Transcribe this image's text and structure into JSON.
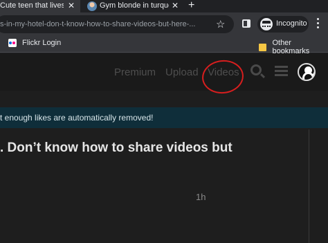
{
  "browser": {
    "tabs": [
      {
        "title": "Cute teen that lives in",
        "active": true
      },
      {
        "title": "Gym blonde in turquoi",
        "active": false
      }
    ],
    "close_glyph": "✕",
    "new_tab_glyph": "+",
    "url": "s-in-my-hotel-don-t-know-how-to-share-videos-but-here-...",
    "star_glyph": "☆",
    "incognito_label": "Incognito",
    "bookmarks": [
      {
        "label": "Flickr Login",
        "icon": "flickr-icon"
      },
      {
        "label": "Other bookmarks",
        "icon": "folder-icon"
      }
    ]
  },
  "site": {
    "nav": [
      "Premium",
      "Upload",
      "Videos"
    ],
    "icons": [
      "search-icon",
      "hamburger-icon",
      "yinyang-icon"
    ],
    "notice": "t enough likes are automatically removed!",
    "post_title": ". Don’t know how to share videos but",
    "post_time": "1h"
  },
  "colors": {
    "page_bg": "#1e1e1e",
    "notice_bg": "#0f2e3a",
    "annotation_red": "#d81e1e"
  }
}
